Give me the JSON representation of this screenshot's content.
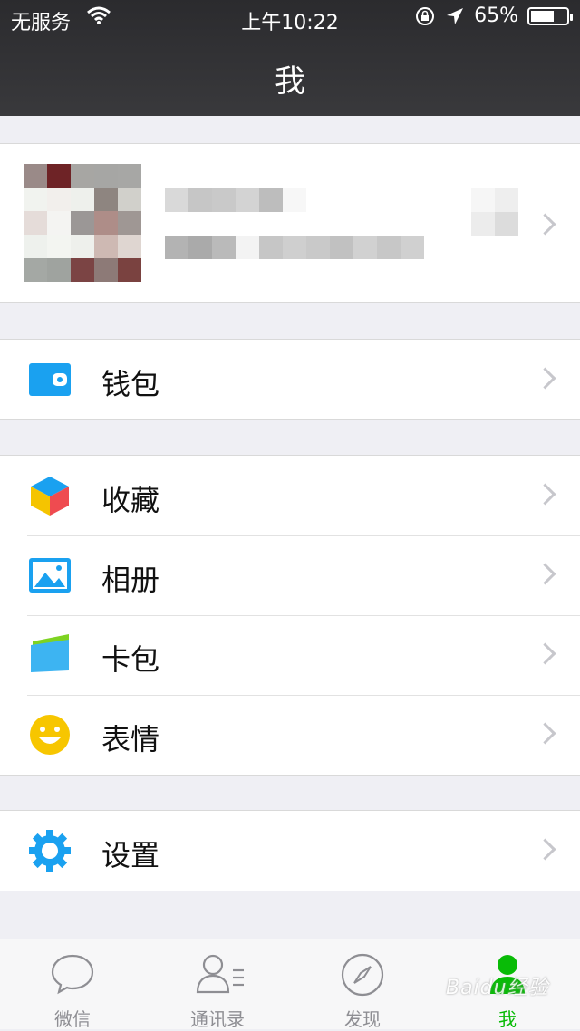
{
  "status_bar": {
    "carrier": "无服务",
    "time": "上午10:22",
    "battery": "65%",
    "battery_level": 0.65
  },
  "nav": {
    "title": "我"
  },
  "wallet_section": [
    {
      "label": "钱包",
      "icon": "wallet-icon"
    }
  ],
  "main_section": [
    {
      "label": "收藏",
      "icon": "favorites-cube-icon"
    },
    {
      "label": "相册",
      "icon": "album-photo-icon"
    },
    {
      "label": "卡包",
      "icon": "card-pack-icon"
    },
    {
      "label": "表情",
      "icon": "sticker-smiley-icon"
    }
  ],
  "settings_section": [
    {
      "label": "设置",
      "icon": "settings-gear-icon"
    }
  ],
  "tabbar": {
    "tabs": [
      {
        "label": "微信",
        "icon": "chat-bubble-icon"
      },
      {
        "label": "通讯录",
        "icon": "contacts-icon"
      },
      {
        "label": "发现",
        "icon": "compass-icon"
      },
      {
        "label": "我",
        "icon": "person-icon",
        "active": true
      }
    ],
    "active_color": "#09bb07",
    "inactive_color": "#8e8e93"
  },
  "watermark": "Baidu经验"
}
